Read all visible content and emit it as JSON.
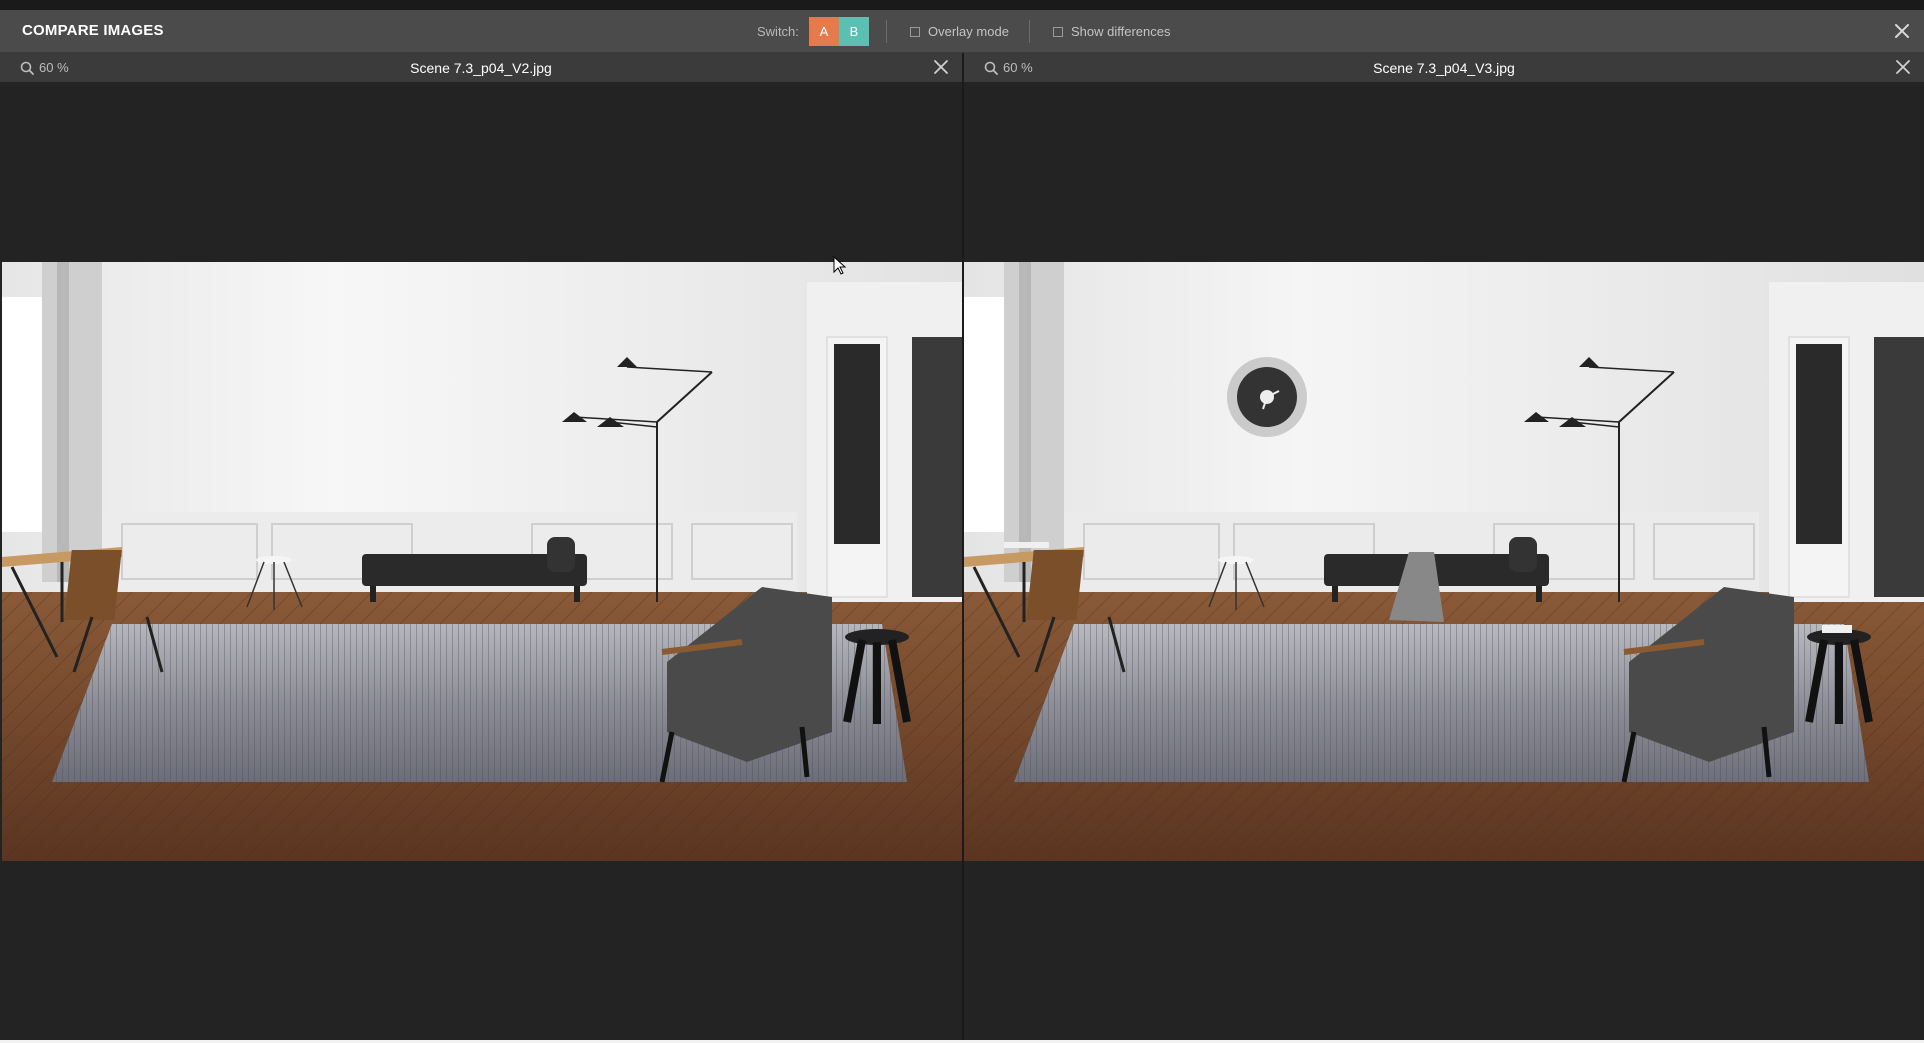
{
  "header": {
    "title": "COMPARE IMAGES",
    "switch_label": "Switch:",
    "switch_a": "A",
    "switch_b": "B",
    "overlay_label": "Overlay mode",
    "diff_label": "Show differences"
  },
  "colors": {
    "switch_a": "#e57a4c",
    "switch_b": "#5bbfb1"
  },
  "panes": [
    {
      "zoom": "60 %",
      "filename": "Scene 7.3_p04_V2.jpg"
    },
    {
      "zoom": "60 %",
      "filename": "Scene 7.3_p04_V3.jpg"
    }
  ],
  "icons": {
    "close": "close-icon",
    "search": "search-icon",
    "cursor": "mouse-cursor-icon"
  }
}
